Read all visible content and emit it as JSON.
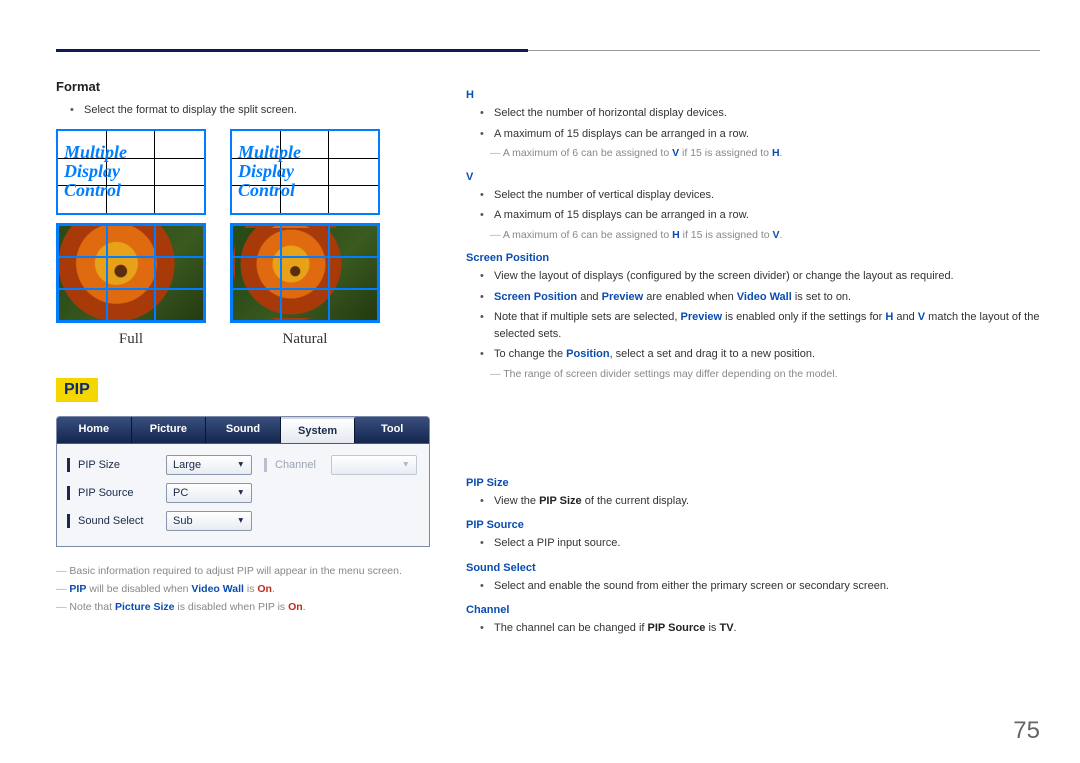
{
  "page_number": "75",
  "left": {
    "format_heading": "Format",
    "format_bullet": "Select the format to display the split screen.",
    "mdc_text_l1": "Multiple",
    "mdc_text_l2": "Display",
    "mdc_text_l3": "Control",
    "label_full": "Full",
    "label_natural": "Natural",
    "pip_badge": "PIP",
    "tabs": {
      "home": "Home",
      "picture": "Picture",
      "sound": "Sound",
      "system": "System",
      "tool": "Tool"
    },
    "rows": {
      "pip_size_label": "PIP Size",
      "pip_size_value": "Large",
      "channel_label": "Channel",
      "pip_source_label": "PIP Source",
      "pip_source_value": "PC",
      "sound_select_label": "Sound Select",
      "sound_select_value": "Sub"
    },
    "notes": {
      "n1": "Basic information required to adjust PIP will appear in the menu screen.",
      "n2_pre": "",
      "n2_pip": "PIP",
      "n2_mid": " will be disabled when ",
      "n2_vw": "Video Wall",
      "n2_is": " is ",
      "n2_on": "On",
      "n2_post": ".",
      "n3_pre": "Note that ",
      "n3_ps": "Picture Size",
      "n3_mid": " is disabled when PIP is ",
      "n3_on": "On",
      "n3_post": "."
    }
  },
  "right": {
    "h_head": "H",
    "h_b1": "Select the number of horizontal display devices.",
    "h_b2": "A maximum of 15 displays can be arranged in a row.",
    "h_note_pre": "A maximum of 6 can be assigned to ",
    "h_note_v": "V",
    "h_note_mid": " if 15 is assigned to ",
    "h_note_h": "H",
    "h_note_post": ".",
    "v_head": "V",
    "v_b1": "Select the number of vertical display devices.",
    "v_b2": "A maximum of 15 displays can be arranged in a row.",
    "v_note_pre": "A maximum of 6 can be assigned to ",
    "v_note_h": "H",
    "v_note_mid": " if 15 is assigned to ",
    "v_note_v": "V",
    "v_note_post": ".",
    "sp_head": "Screen Position",
    "sp_b1": "View the layout of displays (configured by the screen divider) or change the layout as required.",
    "sp_b2_sp": "Screen Position",
    "sp_b2_and": " and ",
    "sp_b2_pv": "Preview",
    "sp_b2_mid": " are enabled when ",
    "sp_b2_vw": "Video Wall",
    "sp_b2_post": " is set to on.",
    "sp_b3_pre": "Note that if multiple sets are selected, ",
    "sp_b3_pv": "Preview",
    "sp_b3_mid": " is enabled only if the settings for ",
    "sp_b3_h": "H",
    "sp_b3_and": " and ",
    "sp_b3_v": "V",
    "sp_b3_post": " match the layout of the selected sets.",
    "sp_b4_pre": "To change the ",
    "sp_b4_pos": "Position",
    "sp_b4_post": ", select a set and drag it to a new position.",
    "sp_note": "The range of screen divider settings may differ depending on the model.",
    "pipsize_head": "PIP Size",
    "pipsize_b1_pre": "View the ",
    "pipsize_b1_bold": "PIP Size",
    "pipsize_b1_post": " of the current display.",
    "pipsrc_head": "PIP Source",
    "pipsrc_b1": "Select a PIP input source.",
    "ss_head": "Sound Select",
    "ss_b1": "Select and enable the sound from either the primary screen or secondary screen.",
    "ch_head": "Channel",
    "ch_b1_pre": "The channel can be changed if ",
    "ch_b1_bold": "PIP Source",
    "ch_b1_mid": " is ",
    "ch_b1_tv": "TV",
    "ch_b1_post": "."
  }
}
